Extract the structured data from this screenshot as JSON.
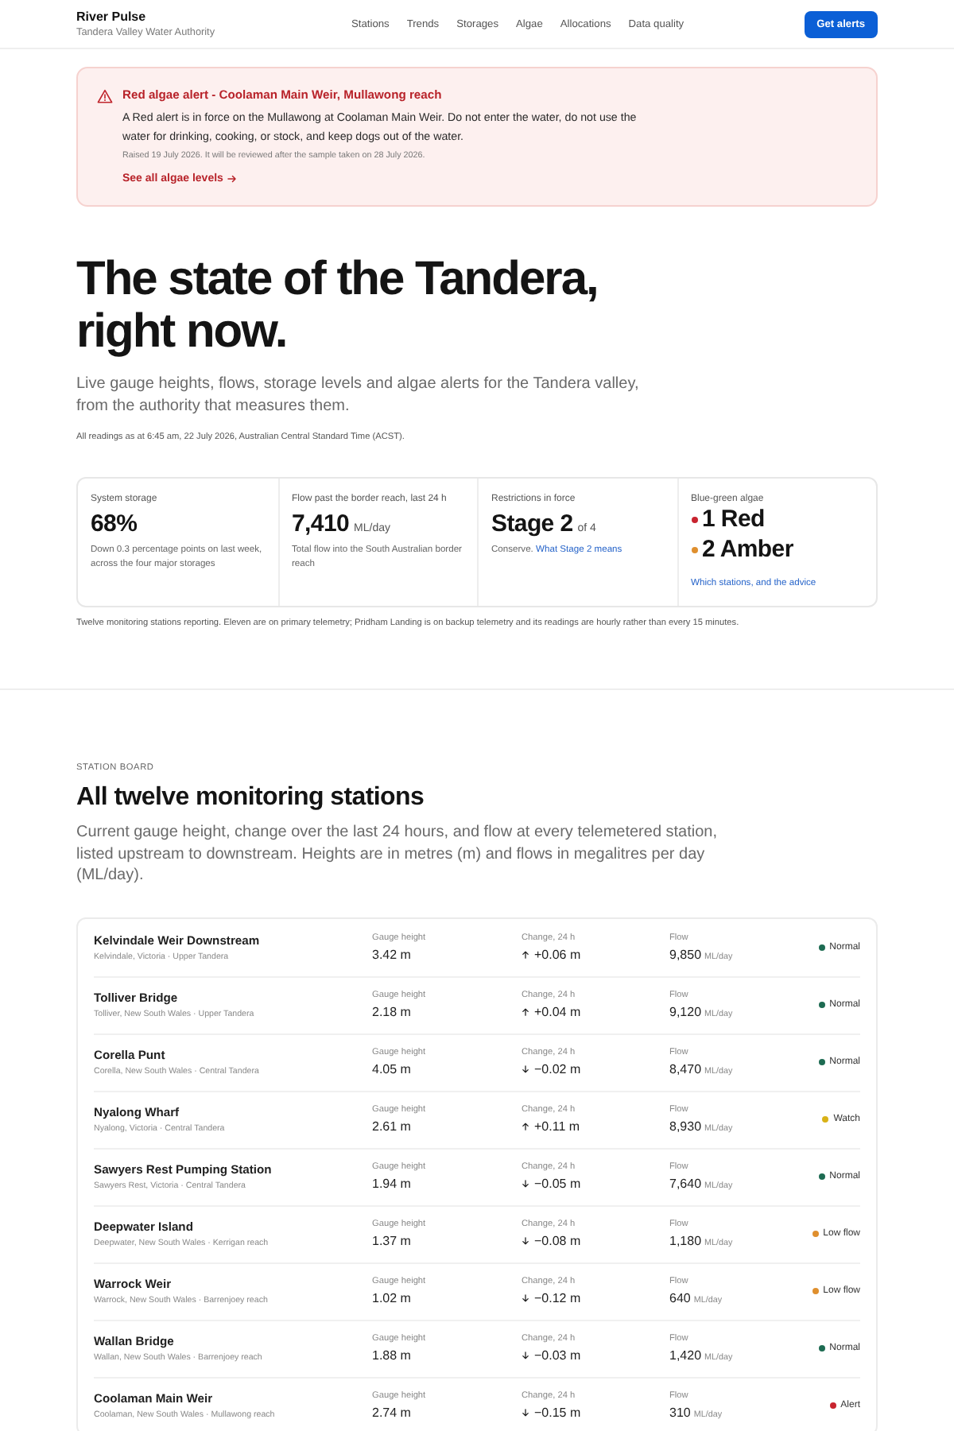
{
  "header": {
    "brand": "River Pulse",
    "subtitle": "Tandera Valley Water Authority",
    "nav": [
      {
        "label": "Stations"
      },
      {
        "label": "Trends"
      },
      {
        "label": "Storages"
      },
      {
        "label": "Algae"
      },
      {
        "label": "Allocations"
      },
      {
        "label": "Data quality"
      }
    ],
    "cta": "Get alerts"
  },
  "alert": {
    "title": "Red algae alert - Coolaman Main Weir, Mullawong reach",
    "message": "A Red alert is in force on the Mullawong at Coolaman Main Weir. Do not enter the water, do not use the water for drinking, cooking, or stock, and keep dogs out of the water.",
    "meta": "Raised 19 July 2026. It will be reviewed after the sample taken on 28 July 2026.",
    "link": "See all algae levels"
  },
  "hero": {
    "title": "The state of the Tandera, right now.",
    "lede": "Live gauge heights, flows, storage levels and algae alerts for the Tandera valley, from the authority that measures them.",
    "timestamp": "All readings as at 6:45 am, 22 July 2026, Australian Central Standard Time (ACST)."
  },
  "stats": [
    {
      "kind": "figure",
      "label": "System storage",
      "value": "68%",
      "note": "Down 0.3 percentage points on last week, across the four major storages"
    },
    {
      "kind": "figure",
      "label": "Flow past the border reach, last 24 h",
      "value": "7,410",
      "unit": "ML/day",
      "note": "Total flow into the South Australian border reach"
    },
    {
      "kind": "figure",
      "label": "Restrictions in force",
      "value": "Stage 2",
      "unit": "of 4",
      "note": "Conserve.",
      "link": "What Stage 2 means"
    },
    {
      "kind": "algae",
      "label": "Blue-green algae",
      "counts": [
        {
          "text": "1 Red",
          "color": "#c8242f"
        },
        {
          "text": "2 Amber",
          "color": "#df8f2e"
        }
      ],
      "link": "Which stations, and the advice"
    }
  ],
  "telemetry_note": "Twelve monitoring stations reporting. Eleven are on primary telemetry; Pridham Landing is on backup telemetry and its readings are hourly rather than every 15 minutes.",
  "board": {
    "eyebrow": "STATION BOARD",
    "heading": "All twelve monitoring stations",
    "lede": "Current gauge height, change over the last 24 hours, and flow at every telemetered station, listed upstream to downstream. Heights are in metres (m) and flows in megalitres per day (ML/day).",
    "stations": [
      {
        "name": "Kelvindale Weir Downstream",
        "place": "Kelvindale, Victoria · Upper Tandera",
        "gauge_label": "Gauge height",
        "gauge": "3.42 m",
        "change_label": "Change, 24 h",
        "kind": "rise",
        "change": "+0.06 m",
        "flow_label": "Flow",
        "flow": "9,850",
        "flow_unit": "ML/day",
        "status": "Normal",
        "color": "#1d6b52"
      },
      {
        "name": "Tolliver Bridge",
        "place": "Tolliver, New South Wales · Upper Tandera",
        "gauge_label": "Gauge height",
        "gauge": "2.18 m",
        "change_label": "Change, 24 h",
        "kind": "rise",
        "change": "+0.04 m",
        "flow_label": "Flow",
        "flow": "9,120",
        "flow_unit": "ML/day",
        "status": "Normal",
        "color": "#1d6b52"
      },
      {
        "name": "Corella Punt",
        "place": "Corella, New South Wales · Central Tandera",
        "gauge_label": "Gauge height",
        "gauge": "4.05 m",
        "change_label": "Change, 24 h",
        "kind": "fall",
        "change": "−0.02 m",
        "flow_label": "Flow",
        "flow": "8,470",
        "flow_unit": "ML/day",
        "status": "Normal",
        "color": "#1d6b52"
      },
      {
        "name": "Nyalong Wharf",
        "place": "Nyalong, Victoria · Central Tandera",
        "gauge_label": "Gauge height",
        "gauge": "2.61 m",
        "change_label": "Change, 24 h",
        "kind": "rise",
        "change": "+0.11 m",
        "flow_label": "Flow",
        "flow": "8,930",
        "flow_unit": "ML/day",
        "status": "Watch",
        "color": "#d9b217"
      },
      {
        "name": "Sawyers Rest Pumping Station",
        "place": "Sawyers Rest, Victoria · Central Tandera",
        "gauge_label": "Gauge height",
        "gauge": "1.94 m",
        "change_label": "Change, 24 h",
        "kind": "fall",
        "change": "−0.05 m",
        "flow_label": "Flow",
        "flow": "7,640",
        "flow_unit": "ML/day",
        "status": "Normal",
        "color": "#1d6b52"
      },
      {
        "name": "Deepwater Island",
        "place": "Deepwater, New South Wales · Kerrigan reach",
        "gauge_label": "Gauge height",
        "gauge": "1.37 m",
        "change_label": "Change, 24 h",
        "kind": "fall",
        "change": "−0.08 m",
        "flow_label": "Flow",
        "flow": "1,180",
        "flow_unit": "ML/day",
        "status": "Low flow",
        "color": "#df8f2e"
      },
      {
        "name": "Warrock Weir",
        "place": "Warrock, New South Wales · Barrenjoey reach",
        "gauge_label": "Gauge height",
        "gauge": "1.02 m",
        "change_label": "Change, 24 h",
        "kind": "fall",
        "change": "−0.12 m",
        "flow_label": "Flow",
        "flow": "640",
        "flow_unit": "ML/day",
        "status": "Low flow",
        "color": "#df8f2e"
      },
      {
        "name": "Wallan Bridge",
        "place": "Wallan, New South Wales · Barrenjoey reach",
        "gauge_label": "Gauge height",
        "gauge": "1.88 m",
        "change_label": "Change, 24 h",
        "kind": "fall",
        "change": "−0.03 m",
        "flow_label": "Flow",
        "flow": "1,420",
        "flow_unit": "ML/day",
        "status": "Normal",
        "color": "#1d6b52"
      },
      {
        "name": "Coolaman Main Weir",
        "place": "Coolaman, New South Wales · Mullawong reach",
        "gauge_label": "Gauge height",
        "gauge": "2.74 m",
        "change_label": "Change, 24 h",
        "kind": "fall",
        "change": "−0.15 m",
        "flow_label": "Flow",
        "flow": "310",
        "flow_unit": "ML/day",
        "status": "Alert",
        "color": "#c8242f"
      }
    ]
  }
}
